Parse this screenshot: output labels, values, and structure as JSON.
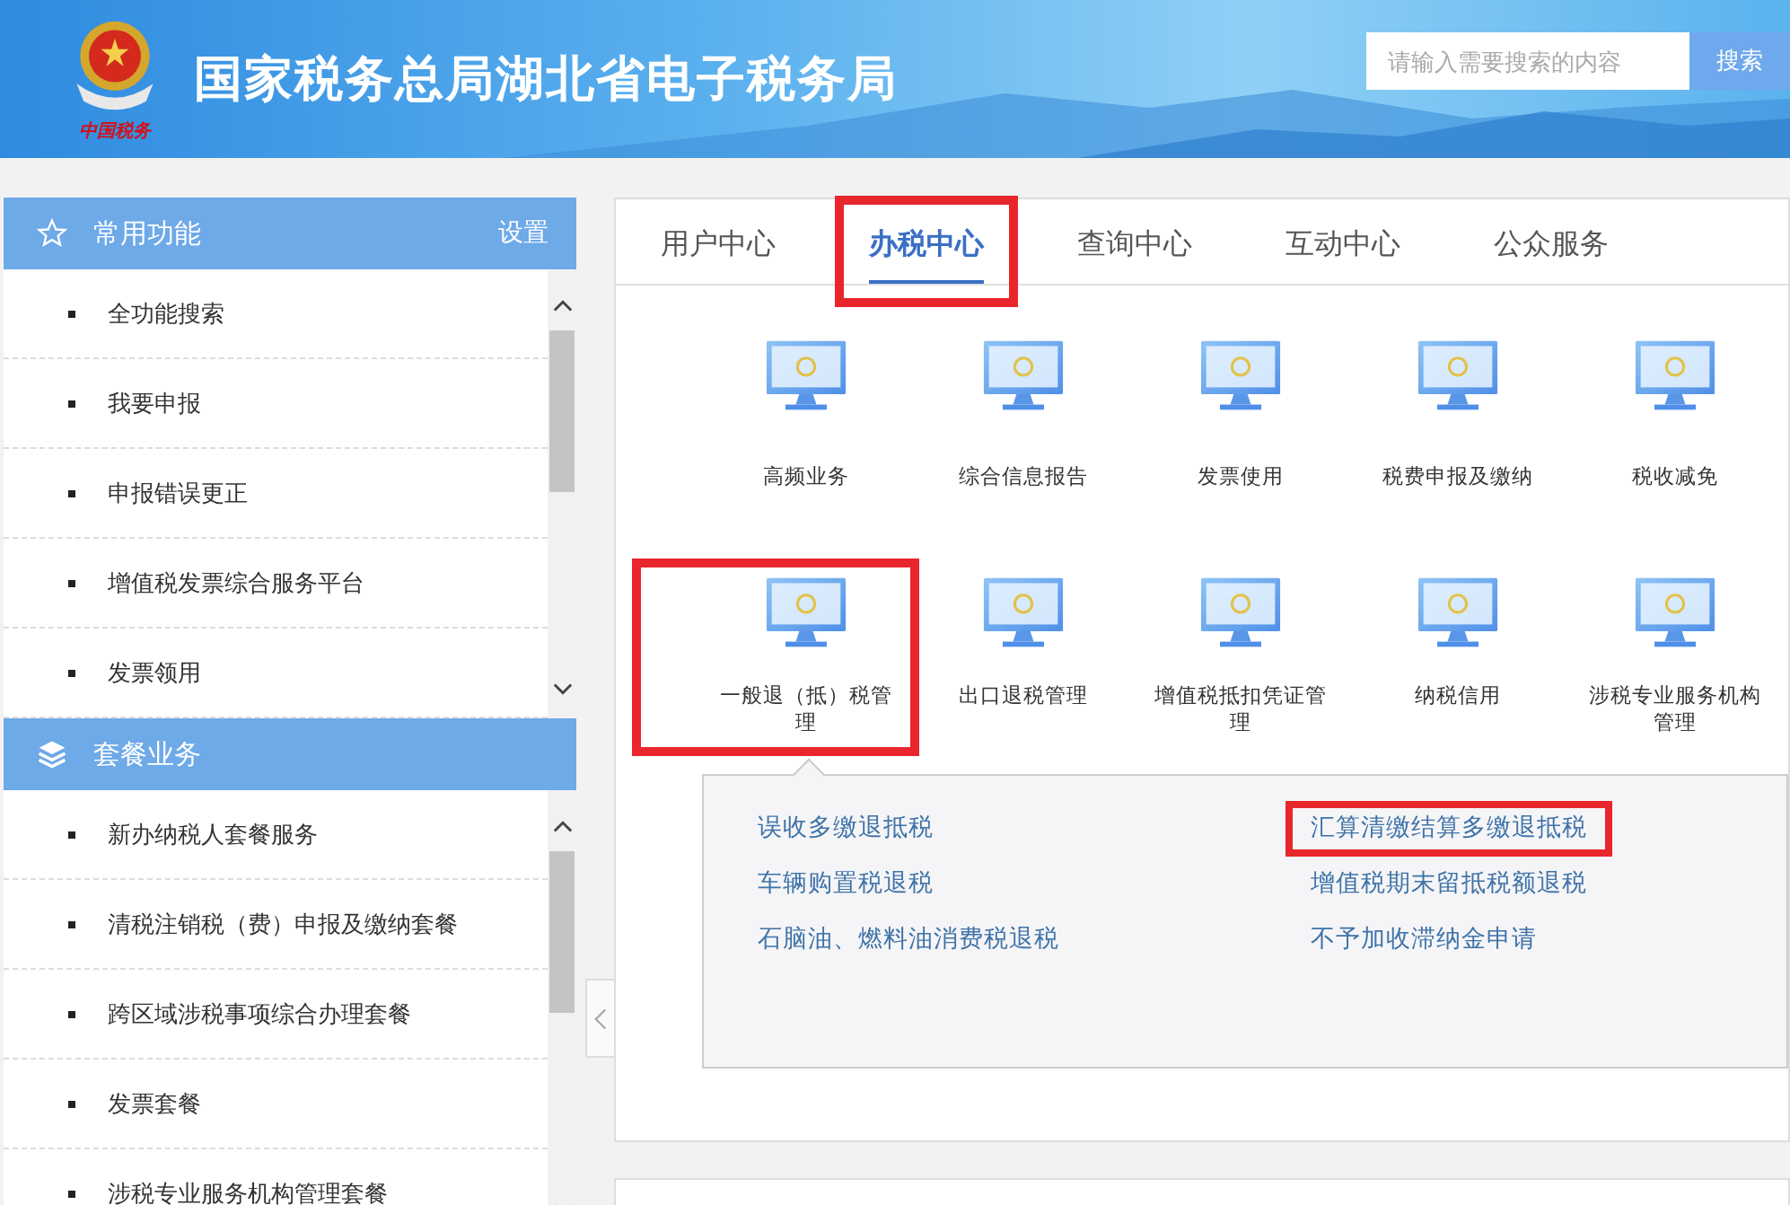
{
  "header": {
    "logo_caption": "中国税务",
    "title": "国家税务总局湖北省电子税务局",
    "search": {
      "placeholder": "请输入需要搜索的内容",
      "button": "搜索"
    }
  },
  "sidebar": {
    "sections": [
      {
        "title": "常用功能",
        "kind": "star",
        "action": "设置",
        "items": [
          "全功能搜索",
          "我要申报",
          "申报错误更正",
          "增值税发票综合服务平台",
          "发票领用"
        ]
      },
      {
        "title": "套餐业务",
        "kind": "layers",
        "items": [
          "新办纳税人套餐服务",
          "清税注销税（费）申报及缴纳套餐",
          "跨区域涉税事项综合办理套餐",
          "发票套餐",
          "涉税专业服务机构管理套餐"
        ]
      }
    ]
  },
  "main": {
    "tabs": [
      {
        "label": "用户中心",
        "selected": false,
        "highlighted": false
      },
      {
        "label": "办税中心",
        "selected": true,
        "highlighted": true
      },
      {
        "label": "查询中心",
        "selected": false,
        "highlighted": false
      },
      {
        "label": "互动中心",
        "selected": false,
        "highlighted": false
      },
      {
        "label": "公众服务",
        "selected": false,
        "highlighted": false
      }
    ],
    "tiles": [
      {
        "label": "高频业务",
        "highlighted": false,
        "expanded": false
      },
      {
        "label": "综合信息报告",
        "highlighted": false,
        "expanded": false
      },
      {
        "label": "发票使用",
        "highlighted": false,
        "expanded": false
      },
      {
        "label": "税费申报及缴纳",
        "highlighted": false,
        "expanded": false
      },
      {
        "label": "税收减免",
        "highlighted": false,
        "expanded": false
      },
      {
        "label": "一般退（抵）税管理",
        "highlighted": true,
        "expanded": true
      },
      {
        "label": "出口退税管理",
        "highlighted": false,
        "expanded": false
      },
      {
        "label": "增值税抵扣凭证管理",
        "highlighted": false,
        "expanded": false
      },
      {
        "label": "纳税信用",
        "highlighted": false,
        "expanded": false
      },
      {
        "label": "涉税专业服务机构管理",
        "highlighted": false,
        "expanded": false
      }
    ],
    "submenu": [
      {
        "label": "误收多缴退抵税",
        "highlighted": false
      },
      {
        "label": "汇算清缴结算多缴退抵税",
        "highlighted": true
      },
      {
        "label": "车辆购置税退税",
        "highlighted": false
      },
      {
        "label": "增值税期末留抵税额退税",
        "highlighted": false
      },
      {
        "label": "石脑油、燃料油消费税退税",
        "highlighted": false
      },
      {
        "label": "不予加收滞纳金申请",
        "highlighted": false
      }
    ]
  }
}
